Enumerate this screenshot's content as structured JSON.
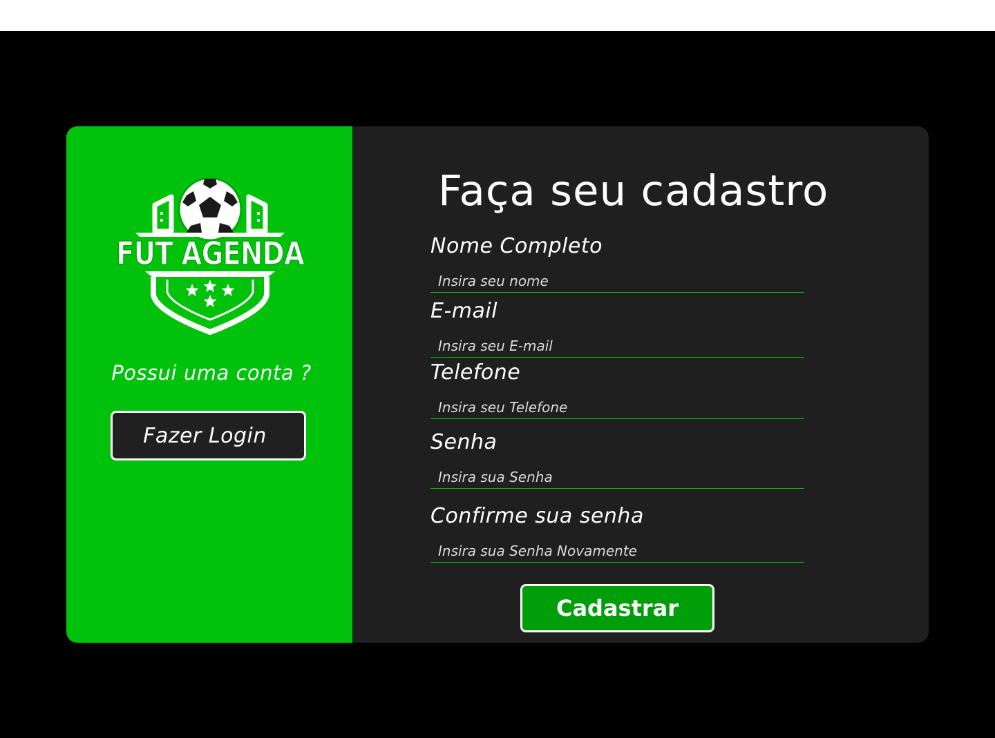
{
  "brand": {
    "logo_text": "FUT AGENDA",
    "logo_icon": "soccer-ball-shield-icon"
  },
  "left_panel": {
    "prompt": "Possui uma conta ?",
    "login_button": "Fazer Login"
  },
  "form": {
    "title": "Faça seu cadastro",
    "fields": [
      {
        "label": "Nome Completo",
        "placeholder": "Insira seu nome",
        "value": ""
      },
      {
        "label": "E-mail",
        "placeholder": "Insira seu E-mail",
        "value": ""
      },
      {
        "label": "Telefone",
        "placeholder": "Insira seu Telefone",
        "value": ""
      },
      {
        "label": "Senha",
        "placeholder": "Insira sua Senha",
        "value": ""
      },
      {
        "label": "Confirme sua senha",
        "placeholder": "Insira sua Senha Novamente",
        "value": ""
      }
    ],
    "submit_button": "Cadastrar"
  },
  "colors": {
    "accent_green": "#00c20b",
    "button_green": "#009e08",
    "card_dark": "#1f1f1f",
    "background": "#000000"
  }
}
